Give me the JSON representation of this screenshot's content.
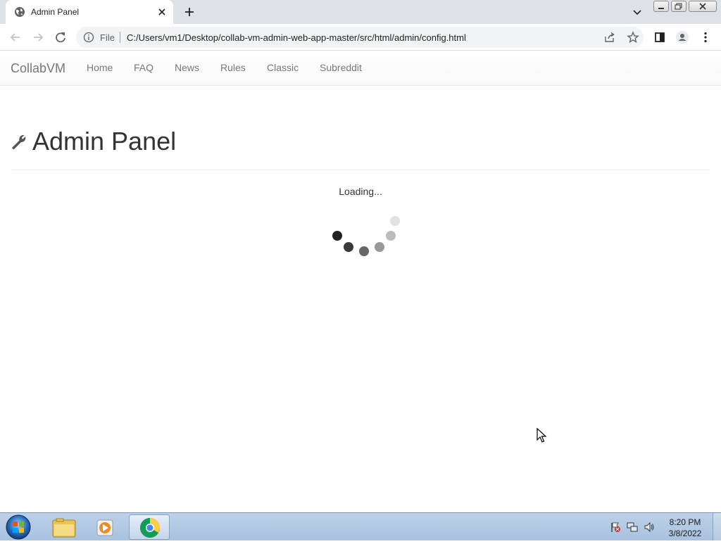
{
  "browser": {
    "tab_title": "Admin Panel",
    "omnibox": {
      "scheme_label": "File",
      "url": "C:/Users/vm1/Desktop/collab-vm-admin-web-app-master/src/html/admin/config.html"
    }
  },
  "site": {
    "brand": "CollabVM",
    "nav": [
      "Home",
      "FAQ",
      "News",
      "Rules",
      "Classic",
      "Subreddit"
    ]
  },
  "main": {
    "title": "Admin Panel",
    "loading_text": "Loading..."
  },
  "taskbar": {
    "clock_time": "8:20 PM",
    "clock_date": "3/8/2022"
  }
}
